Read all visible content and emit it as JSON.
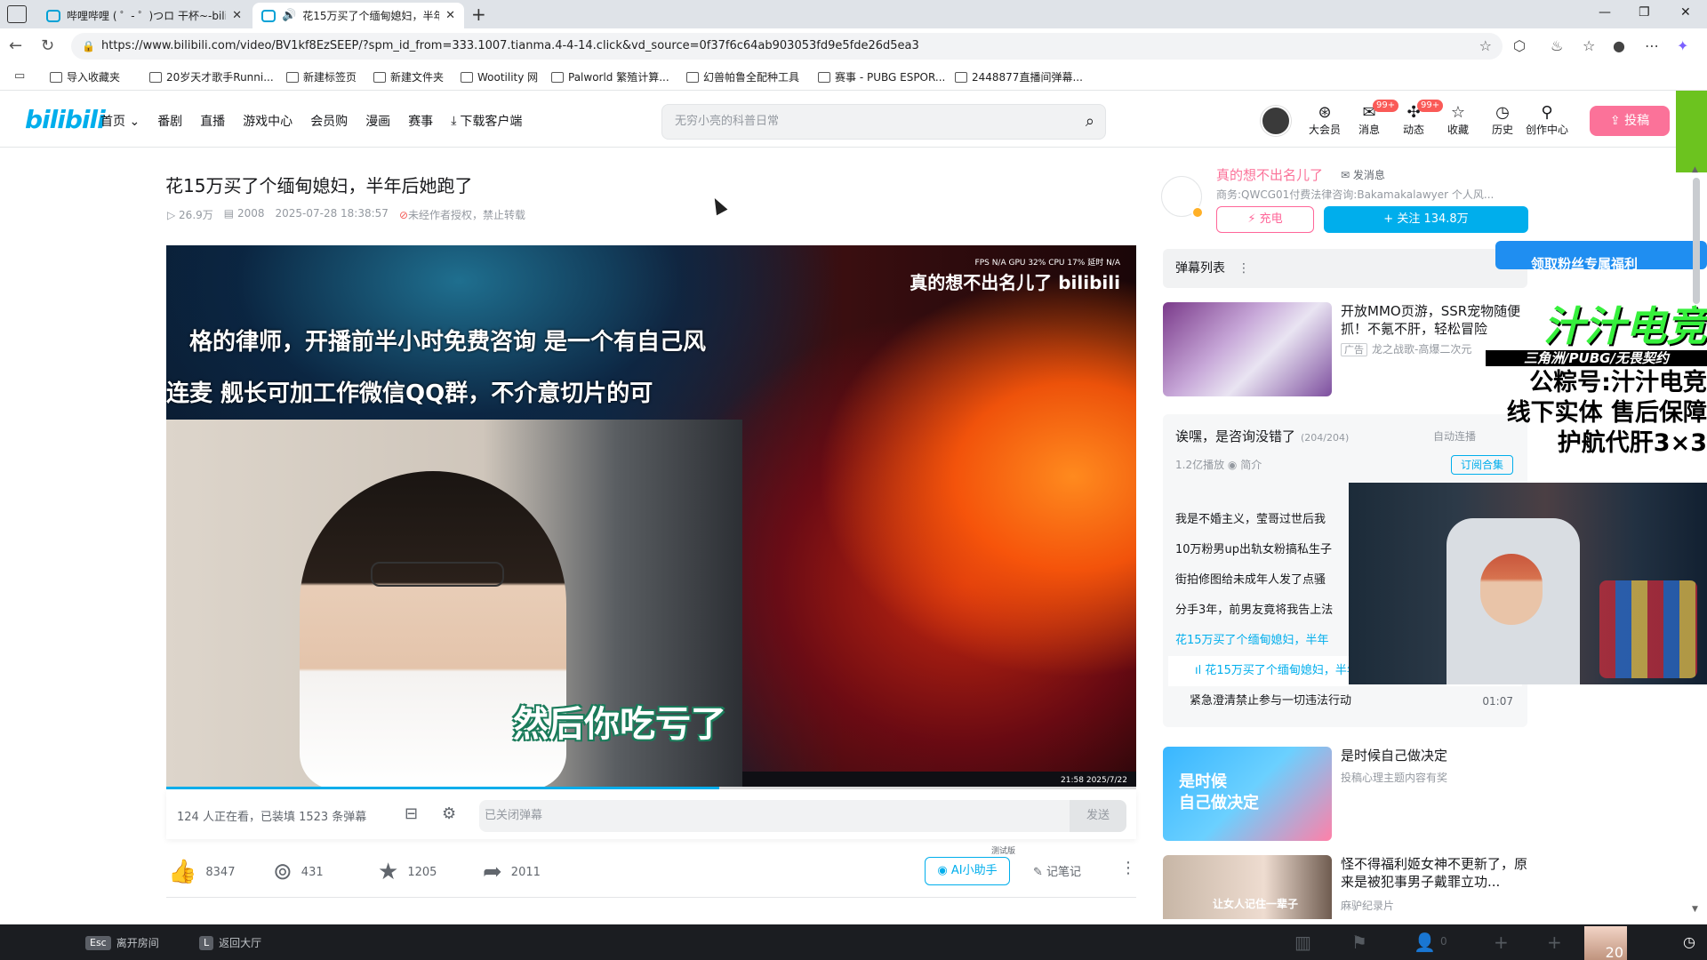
{
  "browser": {
    "tabs": [
      {
        "title": "哔哩哔哩 ( ゜- ゜)つロ 干杯~-bilibili"
      },
      {
        "title": "花15万买了个缅甸媳妇，半年后她跑了"
      }
    ],
    "url": "https://www.bilibili.com/video/BV1kf8EzSEEP/?spm_id_from=333.1007.tianma.4-4-14.click&vd_source=0f37f6c64ab903053fd9e5fde26d5ea3",
    "bookmarks": [
      "导入收藏夹",
      "20岁天才歌手Runni...",
      "新建标签页",
      "新建文件夹",
      "Wootility 网",
      "Palworld 繁殖计算...",
      "幻兽帕鲁全配种工具",
      "赛事 - PUBG ESPOR...",
      "2448877直播间弹幕..."
    ]
  },
  "header": {
    "logo": "bilibili",
    "nav": [
      "首页",
      "番剧",
      "直播",
      "游戏中心",
      "会员购",
      "漫画",
      "赛事"
    ],
    "download": "下载客户端",
    "search_placeholder": "无穷小亮的科普日常",
    "items": [
      {
        "label": "大会员",
        "badge": ""
      },
      {
        "label": "消息",
        "badge": "99+"
      },
      {
        "label": "动态",
        "badge": "99+"
      },
      {
        "label": "收藏",
        "badge": ""
      },
      {
        "label": "历史",
        "badge": ""
      },
      {
        "label": "创作中心",
        "badge": ""
      }
    ],
    "upload": "投稿"
  },
  "video": {
    "title": "花15万买了个缅甸媳妇，半年后她跑了",
    "views": "26.9万",
    "danmaku_count": "2008",
    "date": "2025-07-28 18:38:57",
    "copyright": "未经作者授权，禁止转载",
    "player": {
      "stats": "FPS N/A GPU 32% CPU 17% 延时 N/A",
      "watermark": "真的想不出名儿了 bilibili",
      "scroll1": "格的律师，开播前半小时免费咨询  是一个有自己风",
      "scroll2": "连麦  舰长可加工作微信QQ群，不介意切片的可",
      "subtitle": "然后你吃亏了",
      "mini_clock": "21:58 2025/7/22",
      "progress": 0.57
    },
    "viewers": "124 人正在看，已装填 1523 条弹幕",
    "danmaku_placeholder": "已关闭弹幕",
    "send": "发送",
    "likes": "8347",
    "coins": "431",
    "favorites": "1205",
    "shares": "2011",
    "ai_helper": "AI小助手",
    "ai_tag": "测试版",
    "notes": "记笔记"
  },
  "up": {
    "name": "真的想不出名儿了",
    "message": "发消息",
    "desc": "商务:QWCG01付费法律咨询:Bakamakalawyer 个人风...",
    "charge": "充电",
    "follow": "关注 134.8万"
  },
  "sidebar": {
    "danmaku_list": "弹幕列表",
    "blue_strip": "领取粉丝专属福利",
    "ad": {
      "title": "开放MMO页游，SSR宠物随便抓！不氪不肝，轻松冒险",
      "label": "广告",
      "source": "龙之战歌-高爆二次元"
    },
    "playlist": {
      "title": "诶嘿，是咨询没错了",
      "count": "(204/204)",
      "auto": "自动连播",
      "plays": "1.2亿播放",
      "intro": "简介",
      "subscribe": "订阅合集",
      "items": [
        {
          "title": "我是不婚主义，莹哥过世后我"
        },
        {
          "title": "10万粉男up出轨女粉搞私生子"
        },
        {
          "title": "街拍修图给未成年人发了点骚"
        },
        {
          "title": "分手3年，前男友竟将我告上法"
        },
        {
          "title": "花15万买了个缅甸媳妇，半年"
        }
      ],
      "sub_item": "花15万买了个缅甸媳妇，半年后她跑了",
      "next_item": {
        "title": "紧急澄清禁止参与一切违法行动",
        "duration": "01:07"
      }
    },
    "rec1": {
      "title": "是时候自己做决定",
      "source": "投稿心理主题内容有奖",
      "thumb_text": "是时候\n自己做决定"
    },
    "rec2": {
      "title": "怪不得福利姬女神不更新了，原来是被犯事男子戴罪立功...",
      "source": "麻驴纪录片",
      "thumb_text": "让女人记住一辈子"
    }
  },
  "overlay": {
    "brand": "汁汁电竞",
    "strip": "三角洲/PUBG/无畏契约",
    "line1": "公粽号:汁汁电竞",
    "line2": "线下实体 售后保障",
    "line3": "护航代肝3×3"
  },
  "gamebar": {
    "esc_key": "Esc",
    "esc_label": "离开房间",
    "l_key": "L",
    "l_label": "返回大厅",
    "players": "0",
    "avatar_num": "20"
  }
}
